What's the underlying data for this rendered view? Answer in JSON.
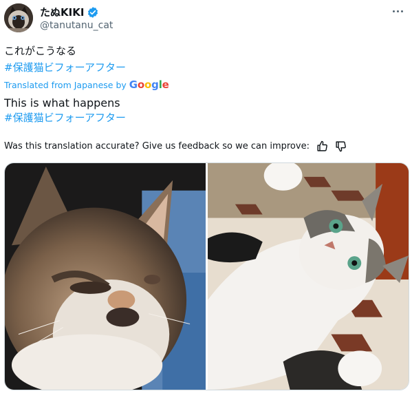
{
  "user": {
    "display_name": "たぬKIKI",
    "handle": "@tanutanu_cat",
    "avatar_icon": "cat-avatar-icon",
    "verified_icon": "verified-badge-icon"
  },
  "tweet": {
    "original_text": "これがこうなる",
    "hashtag": "#保護猫ビフォーアフター",
    "translated_from": "Translated from Japanese by",
    "google_letters": [
      {
        "ch": "G",
        "color": "#4285f4"
      },
      {
        "ch": "o",
        "color": "#ea4335"
      },
      {
        "ch": "o",
        "color": "#fbbc05"
      },
      {
        "ch": "g",
        "color": "#4285f4"
      },
      {
        "ch": "l",
        "color": "#34a853"
      },
      {
        "ch": "e",
        "color": "#ea4335"
      }
    ],
    "translation_text": "This is what happens",
    "translation_hashtag": "#保護猫ビフォーアフター"
  },
  "feedback": {
    "question": "Was this translation accurate? Give us feedback so we can improve:",
    "thumbs_up_icon": "thumbs-up-icon",
    "thumbs_down_icon": "thumbs-down-icon"
  },
  "media": {
    "before_photo": "sick-kitten-photo",
    "after_photo": "healthy-cat-photo"
  },
  "colors": {
    "accent": "#1d9bf0",
    "text": "#0f1419",
    "secondary": "#536471"
  }
}
